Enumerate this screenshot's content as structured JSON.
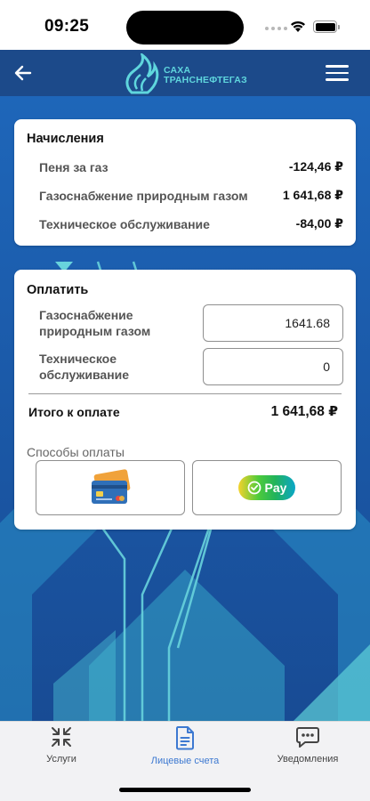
{
  "status_bar": {
    "time": "09:25"
  },
  "header": {
    "logo_line1": "САХА",
    "logo_line2": "ТРАНСНЕФТЕГАЗ",
    "back_icon": "arrow-left-icon",
    "menu_icon": "hamburger-menu-icon"
  },
  "accruals": {
    "title": "Начисления",
    "rows": [
      {
        "label": "Пеня за газ",
        "value": "-124,46 ₽"
      },
      {
        "label": "Газоснабжение природным газом",
        "value": "1 641,68 ₽"
      },
      {
        "label": "Техническое обслуживание",
        "value": "-84,00 ₽"
      }
    ]
  },
  "payment": {
    "title": "Оплатить",
    "items": [
      {
        "label": "Газоснабжение природным газом",
        "value": "1641.68"
      },
      {
        "label": "Техническое обслуживание",
        "value": "0"
      }
    ],
    "total_label": "Итого к оплате",
    "total_value": "1 641,68 ₽",
    "methods_label": "Способы оплаты",
    "method_card_icon": "bank-cards-icon",
    "method_sbp_label": "Pay"
  },
  "bottom_nav": {
    "items": [
      {
        "label": "Услуги",
        "icon": "collapse-arrows-icon"
      },
      {
        "label": "Лицевые счета",
        "icon": "document-icon",
        "active": true
      },
      {
        "label": "Уведомления",
        "icon": "chat-bubble-icon"
      }
    ]
  },
  "colors": {
    "header_bg": "#1c4a8a",
    "accent": "#3d79d1",
    "logo": "#5fd6dd"
  }
}
